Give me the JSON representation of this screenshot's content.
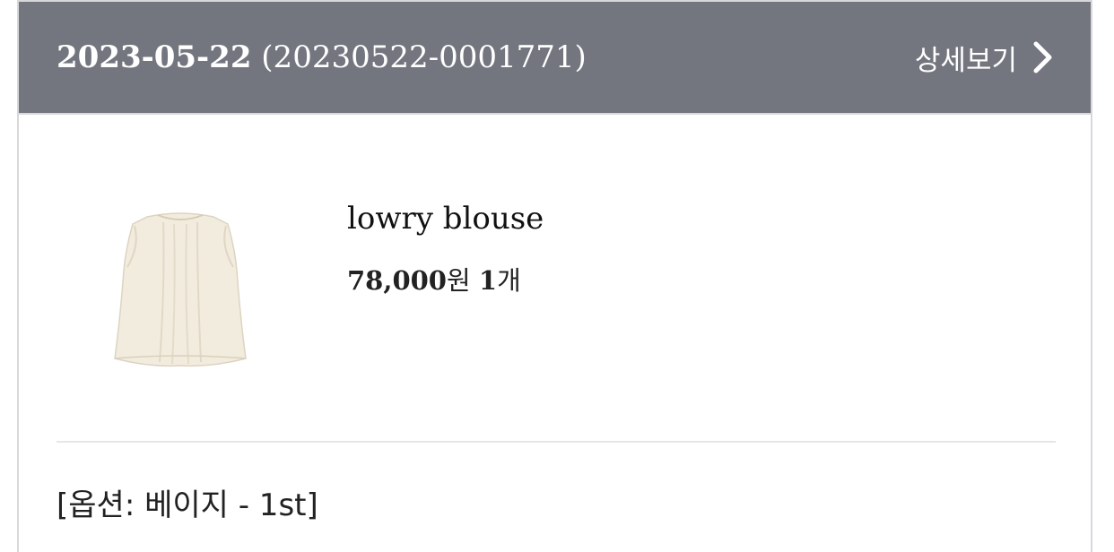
{
  "order": {
    "date": "2023-05-22",
    "number": "(20230522-0001771)",
    "detail_link_label": "상세보기"
  },
  "item": {
    "name": "lowry blouse",
    "price": "78,000",
    "currency": "원",
    "quantity": "1",
    "quantity_unit": "개",
    "thumbnail_icon": "blouse-thumbnail"
  },
  "option": {
    "text": "[옵션: 베이지 - 1st]"
  },
  "colors": {
    "header_bg": "#74767f",
    "header_text": "#ffffff",
    "blouse": "#f2ecdf"
  }
}
